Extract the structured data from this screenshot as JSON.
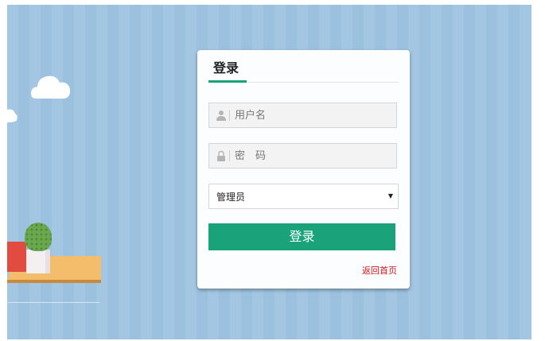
{
  "login": {
    "title": "登录",
    "username": {
      "value": "",
      "placeholder": "用户名"
    },
    "password": {
      "value": "",
      "placeholder": "密　码"
    },
    "role": {
      "selected": "管理员"
    },
    "submit_label": "登录",
    "back_home_label": "返回首页"
  },
  "icons": {
    "username": "user-icon",
    "password": "lock-icon",
    "role": "chevron-down-icon"
  },
  "colors": {
    "accent": "#1aa37a",
    "link": "#d0151a",
    "background": "#a3c6e2"
  }
}
